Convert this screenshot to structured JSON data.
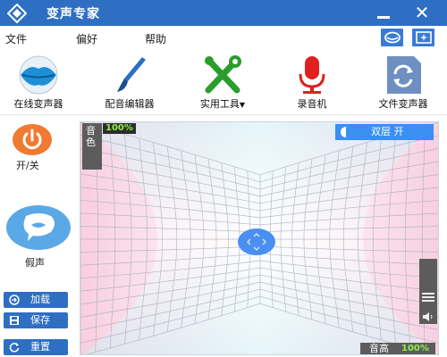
{
  "window": {
    "title": "变声专家",
    "icons": {
      "logo": "diamond-logo-icon",
      "minimize": "minimize-icon",
      "close": "close-icon"
    },
    "close_glyph": "✕"
  },
  "menu": {
    "items": [
      "文件",
      "偏好",
      "帮助"
    ],
    "right_icons": [
      "skin-mask-icon",
      "sparkle-skin-icon"
    ]
  },
  "toolbar": {
    "tools": [
      {
        "label": "在线变声器",
        "icon": "lips-icon"
      },
      {
        "label": "配音编辑器",
        "icon": "paintbrush-icon"
      },
      {
        "label": "实用工具",
        "icon": "tools-wrench-icon",
        "dropdown_glyph": "▼"
      },
      {
        "label": "录音机",
        "icon": "microphone-icon"
      },
      {
        "label": "文件变声器",
        "icon": "file-refresh-icon"
      }
    ]
  },
  "left_panel": {
    "power": {
      "label": "开/关",
      "icon": "power-icon"
    },
    "fake": {
      "label": "假声",
      "icon": "speech-bubble-lips-icon"
    },
    "buttons": [
      {
        "label": "加载",
        "icon": "load-icon"
      },
      {
        "label": "保存",
        "icon": "save-icon"
      },
      {
        "label": "重置",
        "icon": "reset-icon"
      }
    ]
  },
  "pad": {
    "timbre_label": "音色",
    "timbre_percent": "100%",
    "double_label": "双层 开",
    "pitch_label": "音高",
    "pitch_percent": "100%",
    "volume_icon": "speaker-icon"
  },
  "colors": {
    "titlebar": "#2f6fc3",
    "accent_blue": "#3a8ff0",
    "power_orange": "#f07a32",
    "percent_green": "#8ef04a"
  }
}
